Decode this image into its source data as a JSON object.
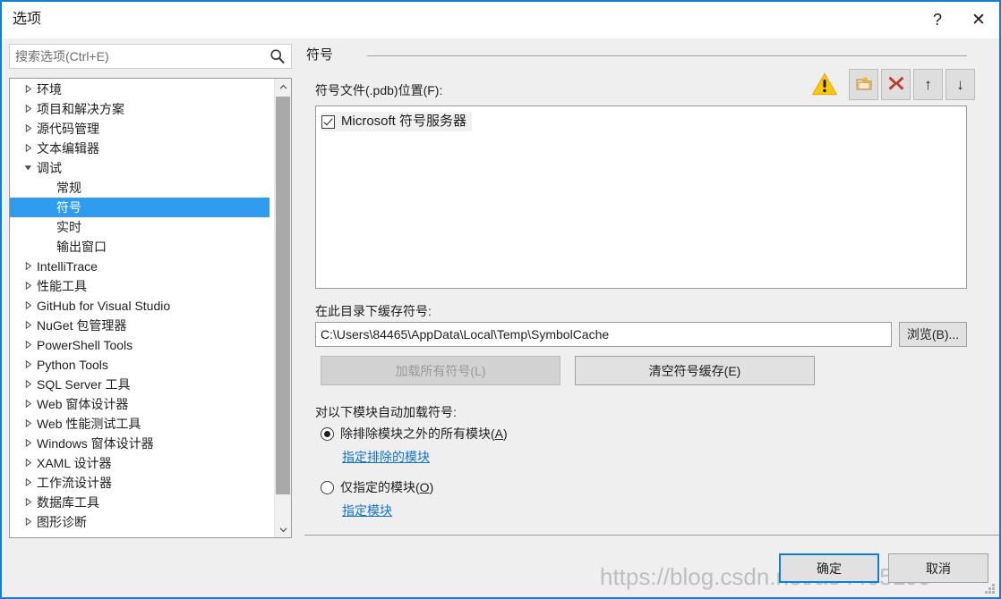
{
  "window": {
    "title": "选项",
    "help_label": "?",
    "close_label": "✕",
    "accent_color": "#0f7fd4",
    "watermark": "https://blog.csdn.net/a84465199"
  },
  "search": {
    "placeholder": "搜索选项(Ctrl+E)",
    "value": "",
    "icon": "search-icon"
  },
  "tree": {
    "selection_color": "#2f9ced",
    "expander_collapsed": "▷",
    "expander_expanded": "◢",
    "scroll_up_label": "︿",
    "scroll_down_label": "﹀",
    "items": [
      {
        "label": "环境",
        "level": 0,
        "expander": "collapsed",
        "selected": false
      },
      {
        "label": "项目和解决方案",
        "level": 0,
        "expander": "collapsed",
        "selected": false
      },
      {
        "label": "源代码管理",
        "level": 0,
        "expander": "collapsed",
        "selected": false
      },
      {
        "label": "文本编辑器",
        "level": 0,
        "expander": "collapsed",
        "selected": false
      },
      {
        "label": "调试",
        "level": 0,
        "expander": "expanded",
        "selected": false
      },
      {
        "label": "常规",
        "level": 1,
        "expander": "none",
        "selected": false
      },
      {
        "label": "符号",
        "level": 1,
        "expander": "none",
        "selected": true
      },
      {
        "label": "实时",
        "level": 1,
        "expander": "none",
        "selected": false
      },
      {
        "label": "输出窗口",
        "level": 1,
        "expander": "none",
        "selected": false
      },
      {
        "label": "IntelliTrace",
        "level": 0,
        "expander": "collapsed",
        "selected": false
      },
      {
        "label": "性能工具",
        "level": 0,
        "expander": "collapsed",
        "selected": false
      },
      {
        "label": "GitHub for Visual Studio",
        "level": 0,
        "expander": "collapsed",
        "selected": false
      },
      {
        "label": "NuGet 包管理器",
        "level": 0,
        "expander": "collapsed",
        "selected": false
      },
      {
        "label": "PowerShell Tools",
        "level": 0,
        "expander": "collapsed",
        "selected": false
      },
      {
        "label": "Python Tools",
        "level": 0,
        "expander": "collapsed",
        "selected": false
      },
      {
        "label": "SQL Server 工具",
        "level": 0,
        "expander": "collapsed",
        "selected": false
      },
      {
        "label": "Web 窗体设计器",
        "level": 0,
        "expander": "collapsed",
        "selected": false
      },
      {
        "label": "Web 性能测试工具",
        "level": 0,
        "expander": "collapsed",
        "selected": false
      },
      {
        "label": "Windows 窗体设计器",
        "level": 0,
        "expander": "collapsed",
        "selected": false
      },
      {
        "label": "XAML 设计器",
        "level": 0,
        "expander": "collapsed",
        "selected": false
      },
      {
        "label": "工作流设计器",
        "level": 0,
        "expander": "collapsed",
        "selected": false
      },
      {
        "label": "数据库工具",
        "level": 0,
        "expander": "collapsed",
        "selected": false
      },
      {
        "label": "图形诊断",
        "level": 0,
        "expander": "collapsed",
        "selected": false
      }
    ]
  },
  "panel": {
    "section_title": "符号",
    "symbol_file_label": "符号文件(.pdb)位置(F):",
    "cache_label": "在此目录下缓存符号:",
    "auto_load_label": "对以下模块自动加载符号:",
    "toolbar": {
      "warning_icon": "warning-triangle-icon",
      "new_location_icon": "new-folder-icon",
      "delete_icon": "red-x-icon",
      "move_up_icon": "arrow-up-icon",
      "move_down_icon": "arrow-down-icon",
      "move_up_glyph": "↑",
      "move_down_glyph": "↓",
      "warning_color": "#ffc80a",
      "delete_color": "#c0392b"
    },
    "symbol_locations": [
      {
        "label": "Microsoft 符号服务器",
        "checked": true,
        "selected": true
      }
    ],
    "cache_path": "C:\\Users\\84465\\AppData\\Local\\Temp\\SymbolCache",
    "browse_label": "浏览(B)...",
    "load_all_label": "加载所有符号(L)",
    "load_all_enabled": false,
    "clear_cache_label": "清空符号缓存(E)",
    "radio_all_except": {
      "label_prefix": "除排除模块之外的所有模块(",
      "accel": "A",
      "label_suffix": ")",
      "selected": true
    },
    "link_excluded": "指定排除的模块",
    "radio_only_specified": {
      "label_prefix": "仅指定的模块(",
      "accel": "O",
      "label_suffix": ")",
      "selected": false
    },
    "link_specify": "指定模块"
  },
  "footer": {
    "ok_label": "确定",
    "cancel_label": "取消"
  }
}
